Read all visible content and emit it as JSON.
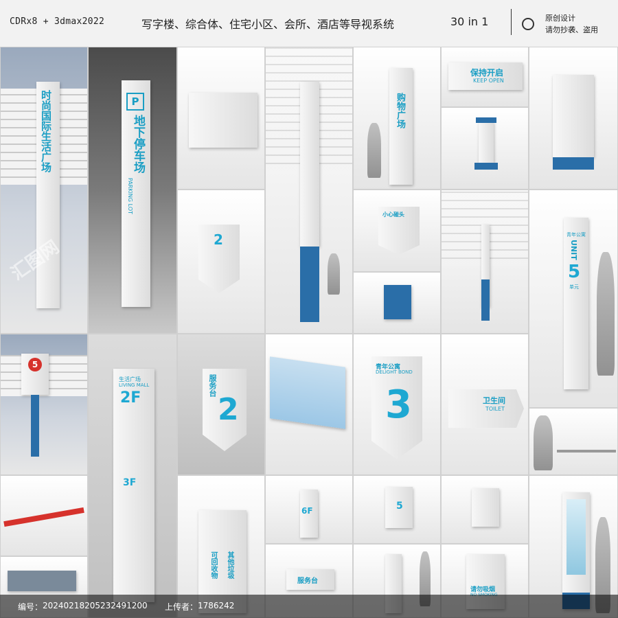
{
  "header": {
    "software": "CDRx8 + 3dmax2022",
    "title": "写字楼、综合体、住宅小区、会所、酒店等导视系统",
    "count": "30 in 1",
    "note_line1": "原创设计",
    "note_line2": "请勿抄袭、盗用",
    "accent": "#1a9ec4"
  },
  "signs": {
    "building_name": "时尚国际生活广场",
    "parking_title": "地下停车场",
    "parking_sub": "PARKING LOT",
    "parking_p": "P",
    "floor2_small": "2",
    "shopping": "购物广场",
    "keep_open_cn": "保持开启",
    "keep_open_en": "KEEP OPEN",
    "careful_cn": "小心碰头",
    "careful_en": "BE CAREFUL",
    "unit_cn": "青年公寓",
    "unit_label": "UNIT",
    "unit_num": "5",
    "unit_sub": "单元",
    "circle_num": "5",
    "living_mall_cn": "生活广场",
    "living_mall_en": "LIVING MALL",
    "floor_2f": "2F",
    "floor_3f": "3F",
    "service_cn": "服务台",
    "service_en": "SERVICE DESK",
    "service_num": "2",
    "delight_cn": "青年公寓",
    "delight_en": "DELIGHT BOND",
    "delight_num": "3",
    "toilet_cn": "卫生间",
    "toilet_en": "TOILET",
    "recycle_cn": "可回收物",
    "recycle_cn2": "其他垃圾",
    "service_desk_cn": "服务台",
    "no_smoking_cn": "请勿吸烟",
    "no_smoking_en": "NO SMOKING",
    "unit_small_num": "5",
    "floor_small": "6F"
  },
  "footer": {
    "id_label": "编号：",
    "id_value": "20240218205232491200",
    "uploader_label": "上传者：",
    "uploader_value": "1786242"
  },
  "watermark": "汇图网"
}
